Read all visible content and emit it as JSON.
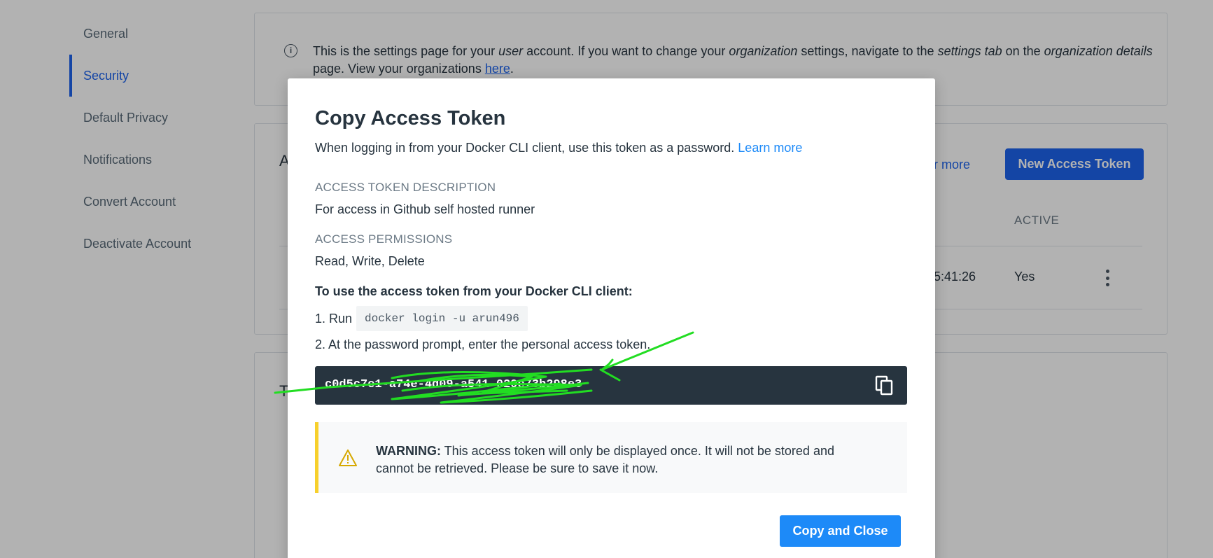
{
  "sidebar": {
    "items": [
      {
        "label": "General",
        "active": false
      },
      {
        "label": "Security",
        "active": true
      },
      {
        "label": "Default Privacy",
        "active": false
      },
      {
        "label": "Notifications",
        "active": false
      },
      {
        "label": "Convert Account",
        "active": false
      },
      {
        "label": "Deactivate Account",
        "active": false
      }
    ]
  },
  "info_banner": {
    "icon": "info-icon",
    "part1": "This is the settings page for your ",
    "em1": "user",
    "part2": " account. If you want to change your ",
    "em2": "organization",
    "part3": " settings, navigate to the ",
    "em3": "settings tab",
    "part4": " on the ",
    "em4": "organization details",
    "part5": " page. View your organizations ",
    "link": "here",
    "part6": "."
  },
  "tokens_card": {
    "heading_partial": "A",
    "learn_more_partial": "e for more",
    "new_token_button": "New Access Token",
    "active_header": "ACTIVE",
    "row": {
      "last_used_partial": "15:41:26",
      "active": "Yes"
    }
  },
  "third_card": {
    "heading_partial": "T"
  },
  "modal": {
    "title": "Copy Access Token",
    "subtitle": "When logging in from your Docker CLI client, use this token as a password. ",
    "subtitle_link": "Learn more",
    "description_label": "ACCESS TOKEN DESCRIPTION",
    "description_value": "For access in Github self hosted runner",
    "permissions_label": "ACCESS PERMISSIONS",
    "permissions_value": "Read, Write, Delete",
    "instructions_heading": "To use the access token from your Docker CLI client:",
    "step1_prefix": "1. Run",
    "step1_command": "docker login -u arun496",
    "step2": "2. At the password prompt, enter the personal access token.",
    "token_value": "c0d5c7e1-a74e-4d09-a541-029e73b298e3",
    "copy_icon": "copy-icon",
    "warning_icon": "warning-icon",
    "warning_label": "WARNING:",
    "warning_text": " This access token will only be displayed once. It will not be stored and cannot be retrieved. Please be sure to save it now.",
    "copy_close_button": "Copy and Close"
  },
  "colors": {
    "accent": "#1d63ed",
    "modal_button": "#1d8af8",
    "token_bg": "#27343f",
    "warning_border": "#f7d02c",
    "annotation_scribble": "#22dd22"
  }
}
